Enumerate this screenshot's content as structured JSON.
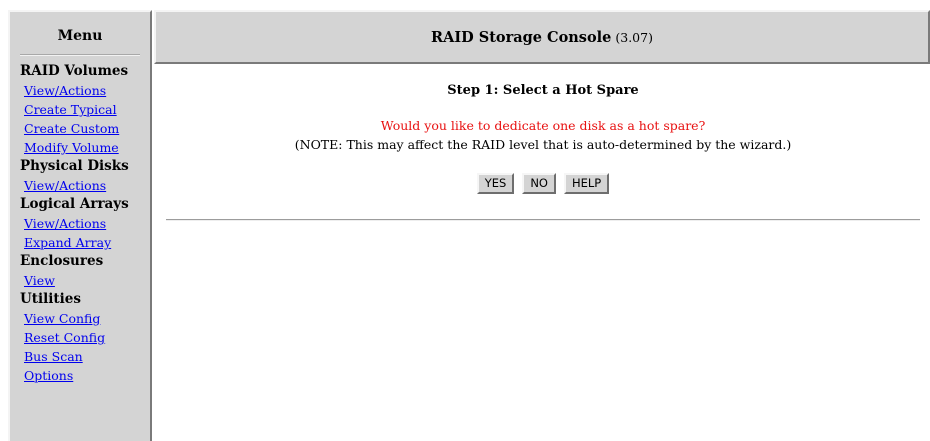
{
  "sidebar": {
    "title": "Menu",
    "sections": [
      {
        "title": "RAID Volumes",
        "items": [
          "View/Actions",
          "Create Typical",
          "Create Custom",
          "Modify Volume"
        ]
      },
      {
        "title": "Physical Disks",
        "items": [
          "View/Actions"
        ]
      },
      {
        "title": "Logical Arrays",
        "items": [
          "View/Actions",
          "Expand Array"
        ]
      },
      {
        "title": "Enclosures",
        "items": [
          "View"
        ]
      },
      {
        "title": "Utilities",
        "items": [
          "View Config",
          "Reset Config",
          "Bus Scan",
          "Options"
        ]
      }
    ]
  },
  "header": {
    "title": "RAID Storage Console",
    "version": "(3.07)"
  },
  "main": {
    "step_title": "Step 1: Select a Hot Spare",
    "question": "Would you like to dedicate one disk as a hot spare?",
    "note": "(NOTE: This may affect the RAID level that is auto-determined by the wizard.)",
    "buttons": {
      "yes": "YES",
      "no": "NO",
      "help": "HELP"
    }
  },
  "colors": {
    "panel_bg": "#d4d4d4",
    "link": "#0000ee",
    "question_text": "#e81010"
  }
}
